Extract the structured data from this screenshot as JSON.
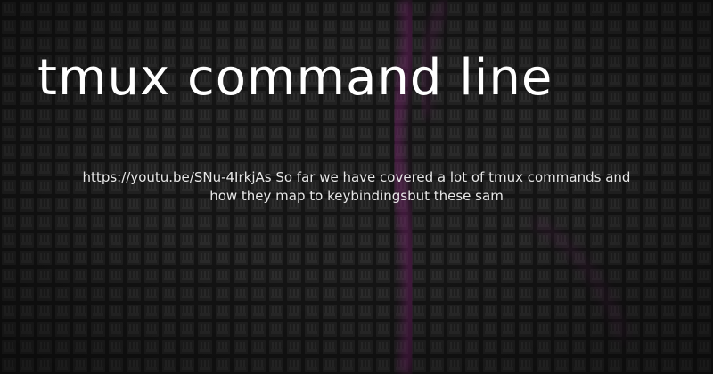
{
  "post": {
    "title": "tmux command line",
    "description": "https://youtu.be/SNu-4IrkjAs So far we have covered a lot of tmux commands and how they map to keybindingsbut these sam"
  },
  "colors": {
    "background": "#161616",
    "tile": "#202020",
    "accent": "#8a2d7c",
    "text": "#ffffff"
  },
  "background_icon": "keyboard-key-grid"
}
